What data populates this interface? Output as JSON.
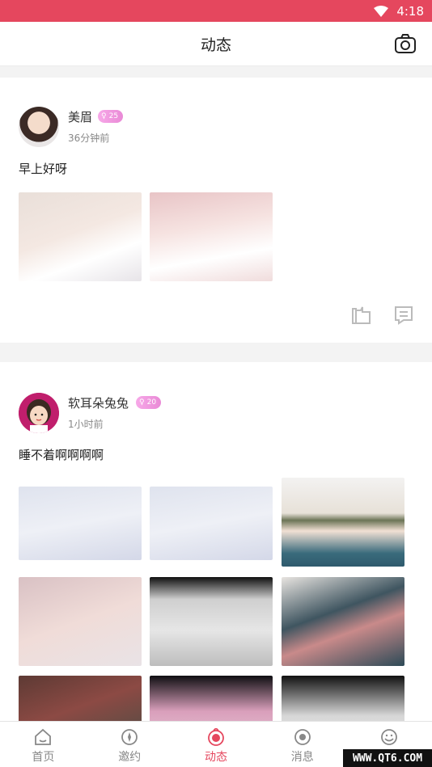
{
  "status_bar": {
    "time": "4:18",
    "color": "#e5475e"
  },
  "header": {
    "title": "动态",
    "camera_icon": "camera-icon"
  },
  "posts": [
    {
      "username": "美眉",
      "badge": "25",
      "time": "36分钟前",
      "text": "早上好呀",
      "photo_count": 2,
      "actions": [
        "share-icon",
        "comment-icon"
      ]
    },
    {
      "username": "软耳朵兔兔",
      "badge": "20",
      "time": "1小时前",
      "text": "睡不着啊啊啊啊",
      "photo_count": 9
    }
  ],
  "nav": [
    {
      "label": "首页",
      "icon": "home-icon",
      "active": false
    },
    {
      "label": "邀约",
      "icon": "invite-icon",
      "active": false
    },
    {
      "label": "动态",
      "icon": "moments-icon",
      "active": true
    },
    {
      "label": "消息",
      "icon": "message-icon",
      "active": false
    },
    {
      "label": "",
      "icon": "profile-icon",
      "active": false
    }
  ],
  "watermark": "WWW.QT6.COM"
}
